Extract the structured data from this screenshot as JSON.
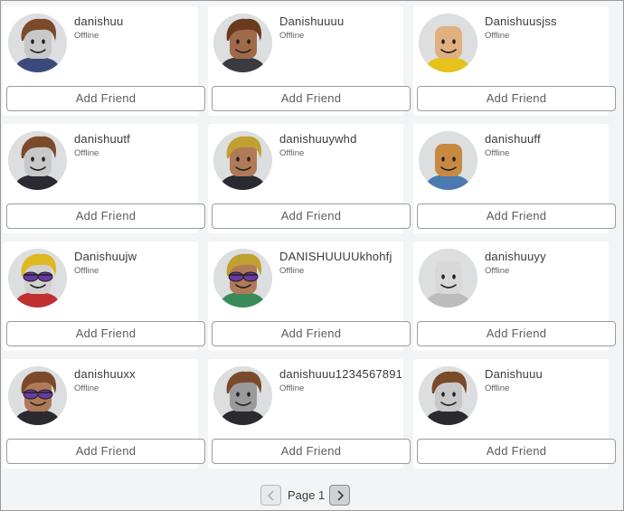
{
  "friends": [
    {
      "username": "danishuu",
      "status": "Offline",
      "button": "Add Friend",
      "avatar": {
        "skin": "#c8c8c8",
        "hair": "#7a4a2a",
        "shirt": "#3a4a7a",
        "accessory": "none",
        "bg": "#dcdedf"
      }
    },
    {
      "username": "Danishuuuu",
      "status": "Offline",
      "button": "Add Friend",
      "avatar": {
        "skin": "#a06a48",
        "hair": "#6a3a1e",
        "shirt": "#3a3a40",
        "accessory": "none",
        "bg": "#dcdedf"
      }
    },
    {
      "username": "Danishuusjss",
      "status": "Offline",
      "button": "Add Friend",
      "avatar": {
        "skin": "#e0b080",
        "hair": "none",
        "shirt": "#e6c21a",
        "accessory": "none",
        "bg": "#dcdedf"
      }
    },
    {
      "username": "danishuutf",
      "status": "Offline",
      "button": "Add Friend",
      "avatar": {
        "skin": "#c8c8c8",
        "hair": "#7a4a2a",
        "shirt": "#2a2a30",
        "accessory": "none",
        "bg": "#dcdedf"
      }
    },
    {
      "username": "danishuuywhd",
      "status": "Offline",
      "button": "Add Friend",
      "avatar": {
        "skin": "#b07a58",
        "hair": "#c0a030",
        "shirt": "#2a2a30",
        "accessory": "none",
        "bg": "#dcdedf"
      }
    },
    {
      "username": "danishuuff",
      "status": "Offline",
      "button": "Add Friend",
      "avatar": {
        "skin": "#c88a40",
        "hair": "none",
        "shirt": "#4a7ab0",
        "accessory": "none",
        "bg": "#dcdedf"
      }
    },
    {
      "username": "Danishuujw",
      "status": "Offline",
      "button": "Add Friend",
      "avatar": {
        "skin": "#d0d0d0",
        "hair": "#e0b820",
        "shirt": "#c03030",
        "accessory": "sunglasses",
        "bg": "#dcdedf"
      }
    },
    {
      "username": "DANISHUUUUkhohfj",
      "status": "Offline",
      "button": "Add Friend",
      "avatar": {
        "skin": "#b07a58",
        "hair": "#c0a030",
        "shirt": "#3a8a5a",
        "accessory": "sunglasses",
        "bg": "#dcdedf"
      }
    },
    {
      "username": "danishuuyy",
      "status": "Offline",
      "button": "Add Friend",
      "avatar": {
        "skin": "#d8d8d8",
        "hair": "none",
        "shirt": "#bcbcbc",
        "accessory": "none",
        "bg": "#dcdedf"
      }
    },
    {
      "username": "danishuuxx",
      "status": "Offline",
      "button": "Add Friend",
      "avatar": {
        "skin": "#b07a58",
        "hair": "#7a4a2a",
        "shirt": "#2a2a30",
        "accessory": "sunglasses",
        "bg": "#dcdedf"
      }
    },
    {
      "username": "danishuuu1234567891",
      "status": "Offline",
      "button": "Add Friend",
      "avatar": {
        "skin": "#9a9a9a",
        "hair": "#7a4a2a",
        "shirt": "#2a2a30",
        "accessory": "none",
        "bg": "#dcdedf"
      }
    },
    {
      "username": "Danishuuu",
      "status": "Offline",
      "button": "Add Friend",
      "avatar": {
        "skin": "#c8c8c8",
        "hair": "#7a4a2a",
        "shirt": "#2a2a30",
        "accessory": "none",
        "bg": "#dcdedf"
      }
    }
  ],
  "pagination": {
    "label": "Page 1",
    "prev_icon": "chevron-left-icon",
    "next_icon": "chevron-right-icon"
  }
}
